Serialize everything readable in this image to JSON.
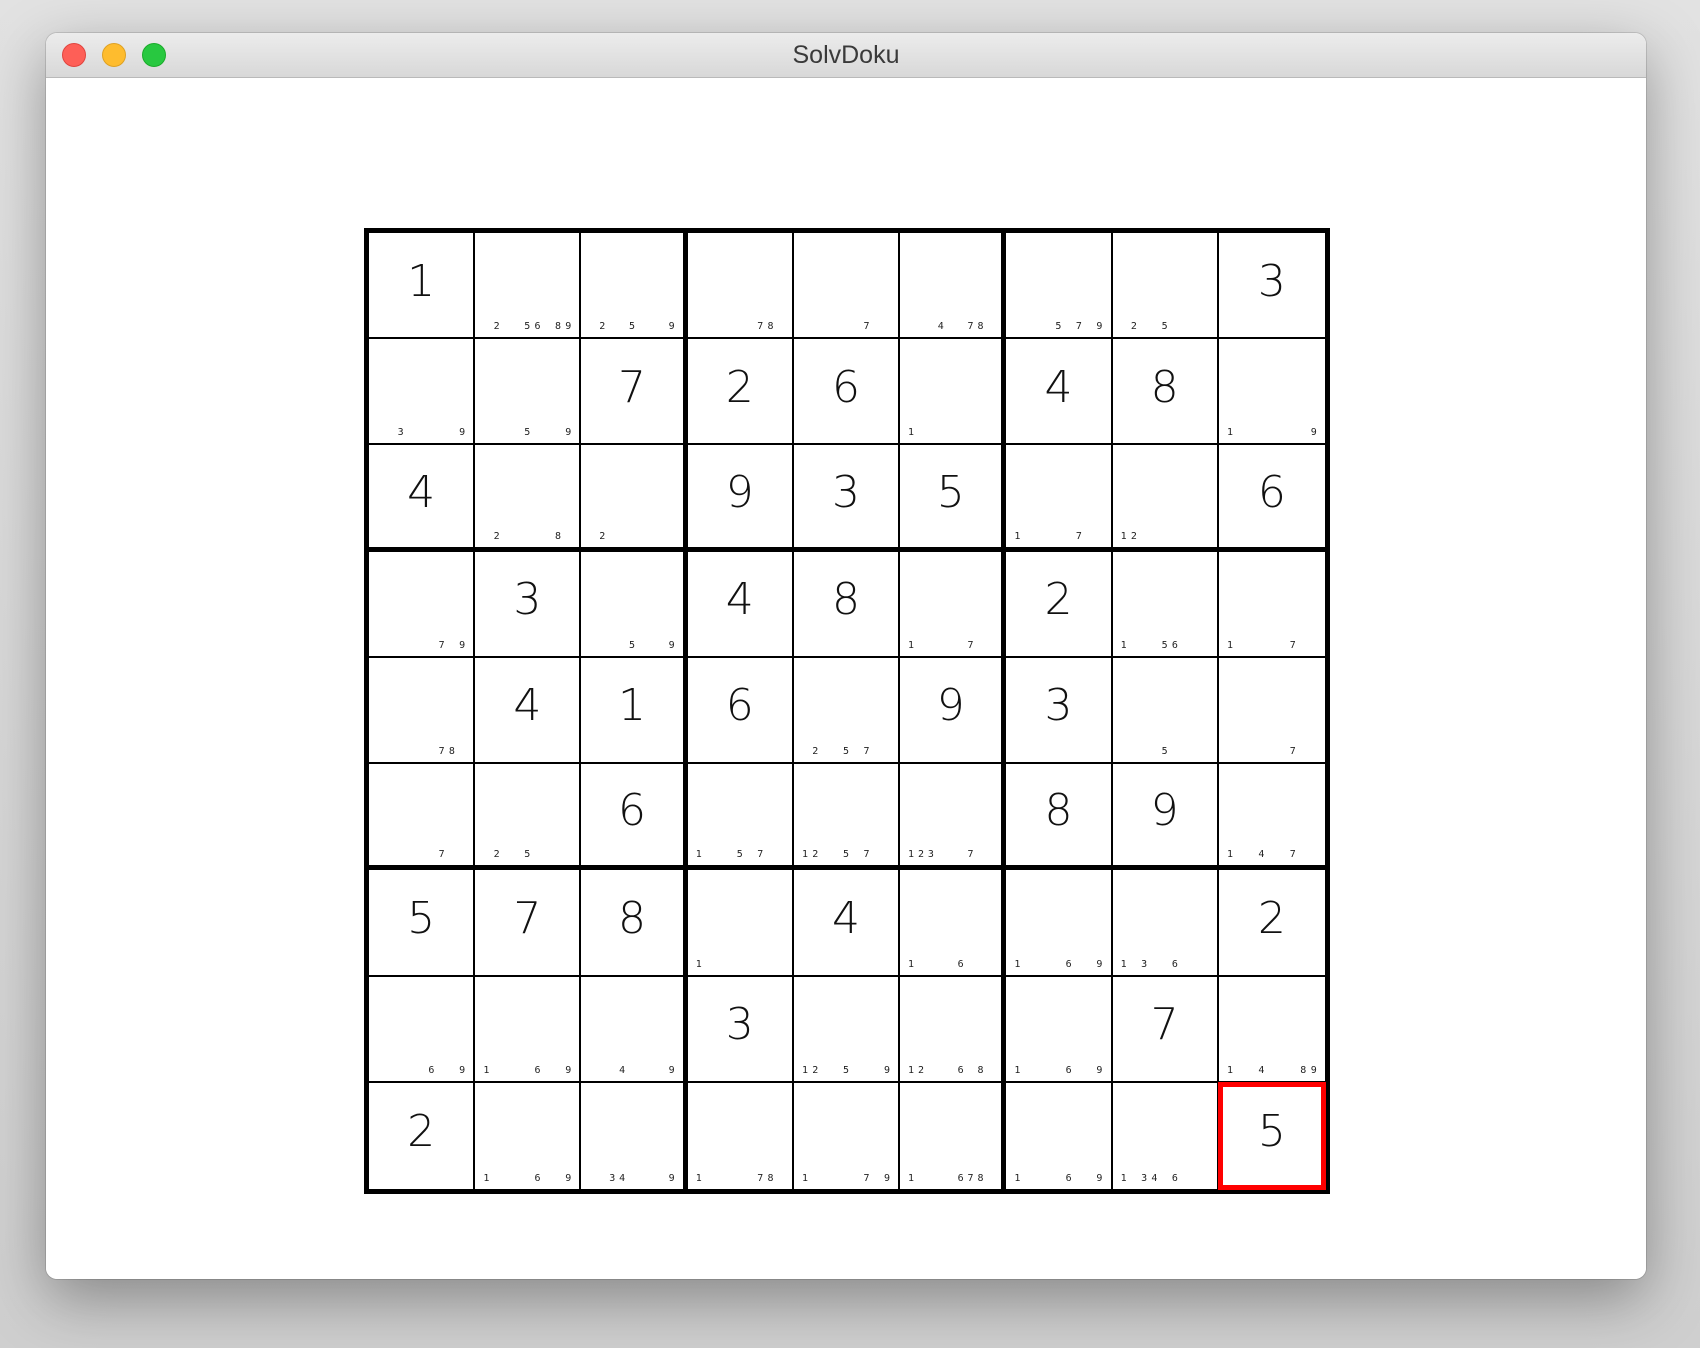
{
  "window": {
    "title": "SolvDoku"
  },
  "colors": {
    "selection": "#ff0000",
    "grid": "#000000",
    "close": "#fe5f57",
    "minimize": "#febc2e",
    "maximize": "#28c840"
  },
  "board": {
    "selected": {
      "row": 8,
      "col": 8
    },
    "cells": [
      [
        {
          "value": "1",
          "notes": ""
        },
        {
          "value": "",
          "notes": "2 5 6 8 9"
        },
        {
          "value": "",
          "notes": "2 5 9"
        },
        {
          "value": "",
          "notes": "7 8"
        },
        {
          "value": "",
          "notes": "7"
        },
        {
          "value": "",
          "notes": "4 7 8"
        },
        {
          "value": "",
          "notes": "5 7 9"
        },
        {
          "value": "",
          "notes": "2 5"
        },
        {
          "value": "3",
          "notes": ""
        }
      ],
      [
        {
          "value": "",
          "notes": "3 9"
        },
        {
          "value": "",
          "notes": "5 9"
        },
        {
          "value": "7",
          "notes": ""
        },
        {
          "value": "2",
          "notes": ""
        },
        {
          "value": "6",
          "notes": ""
        },
        {
          "value": "",
          "notes": "1"
        },
        {
          "value": "4",
          "notes": ""
        },
        {
          "value": "8",
          "notes": ""
        },
        {
          "value": "",
          "notes": "1 9"
        }
      ],
      [
        {
          "value": "4",
          "notes": ""
        },
        {
          "value": "",
          "notes": "2 8"
        },
        {
          "value": "",
          "notes": "2"
        },
        {
          "value": "9",
          "notes": ""
        },
        {
          "value": "3",
          "notes": ""
        },
        {
          "value": "5",
          "notes": ""
        },
        {
          "value": "",
          "notes": "1 7"
        },
        {
          "value": "",
          "notes": "1 2"
        },
        {
          "value": "6",
          "notes": ""
        }
      ],
      [
        {
          "value": "",
          "notes": "7 9"
        },
        {
          "value": "3",
          "notes": ""
        },
        {
          "value": "",
          "notes": "5 9"
        },
        {
          "value": "4",
          "notes": ""
        },
        {
          "value": "8",
          "notes": ""
        },
        {
          "value": "",
          "notes": "1 7"
        },
        {
          "value": "2",
          "notes": ""
        },
        {
          "value": "",
          "notes": "1 5 6"
        },
        {
          "value": "",
          "notes": "1 7"
        }
      ],
      [
        {
          "value": "",
          "notes": "7 8"
        },
        {
          "value": "4",
          "notes": ""
        },
        {
          "value": "1",
          "notes": ""
        },
        {
          "value": "6",
          "notes": ""
        },
        {
          "value": "",
          "notes": "2 5 7"
        },
        {
          "value": "9",
          "notes": ""
        },
        {
          "value": "3",
          "notes": ""
        },
        {
          "value": "",
          "notes": "5"
        },
        {
          "value": "",
          "notes": "7"
        }
      ],
      [
        {
          "value": "",
          "notes": "7"
        },
        {
          "value": "",
          "notes": "2 5"
        },
        {
          "value": "6",
          "notes": ""
        },
        {
          "value": "",
          "notes": "1 5 7"
        },
        {
          "value": "",
          "notes": "1 2 5 7"
        },
        {
          "value": "",
          "notes": "1 2 3 7"
        },
        {
          "value": "8",
          "notes": ""
        },
        {
          "value": "9",
          "notes": ""
        },
        {
          "value": "",
          "notes": "1 4 7"
        }
      ],
      [
        {
          "value": "5",
          "notes": ""
        },
        {
          "value": "7",
          "notes": ""
        },
        {
          "value": "8",
          "notes": ""
        },
        {
          "value": "",
          "notes": "1"
        },
        {
          "value": "4",
          "notes": ""
        },
        {
          "value": "",
          "notes": "1 6"
        },
        {
          "value": "",
          "notes": "1 6 9"
        },
        {
          "value": "",
          "notes": "1 3 6"
        },
        {
          "value": "2",
          "notes": ""
        }
      ],
      [
        {
          "value": "",
          "notes": "6 9"
        },
        {
          "value": "",
          "notes": "1 6 9"
        },
        {
          "value": "",
          "notes": "4 9"
        },
        {
          "value": "3",
          "notes": ""
        },
        {
          "value": "",
          "notes": "1 2 5 9"
        },
        {
          "value": "",
          "notes": "1 2 6 8"
        },
        {
          "value": "",
          "notes": "1 6 9"
        },
        {
          "value": "7",
          "notes": ""
        },
        {
          "value": "",
          "notes": "1 4 8 9"
        }
      ],
      [
        {
          "value": "2",
          "notes": ""
        },
        {
          "value": "",
          "notes": "1 6 9"
        },
        {
          "value": "",
          "notes": "3 4 9"
        },
        {
          "value": "",
          "notes": "1 7 8"
        },
        {
          "value": "",
          "notes": "1 7 9"
        },
        {
          "value": "",
          "notes": "1 6 7 8"
        },
        {
          "value": "",
          "notes": "1 6 9"
        },
        {
          "value": "",
          "notes": "1 3 4 6"
        },
        {
          "value": "5",
          "notes": ""
        }
      ]
    ]
  }
}
